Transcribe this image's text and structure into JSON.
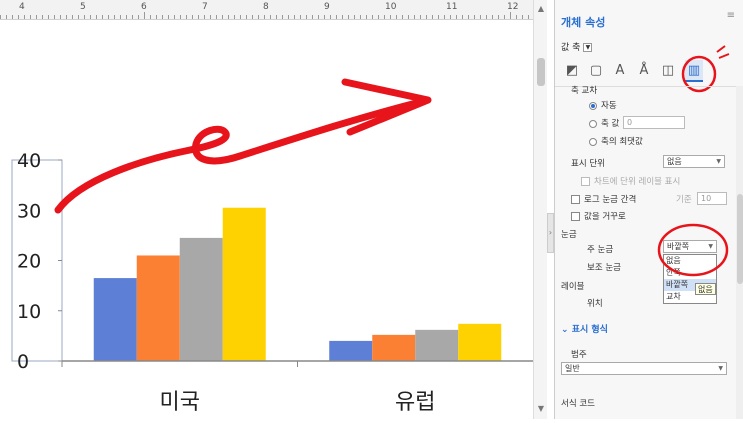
{
  "ruler": {
    "numbers": [
      "4",
      "5",
      "6",
      "7",
      "8",
      "9",
      "10",
      "11",
      "12"
    ]
  },
  "chart_data": {
    "type": "bar",
    "categories": [
      "미국",
      "유럽"
    ],
    "series": [
      {
        "values": [
          16.5,
          4
        ],
        "color": "#5e7fd6"
      },
      {
        "values": [
          21,
          5.2
        ],
        "color": "#fb8034"
      },
      {
        "values": [
          24.5,
          6.2
        ],
        "color": "#a8a8a8"
      },
      {
        "values": [
          30.5,
          7.4
        ],
        "color": "#fdd200"
      }
    ],
    "ylim": [
      0,
      40
    ],
    "yticks": [
      "0",
      "10",
      "20",
      "30",
      "40"
    ],
    "grid": false
  },
  "panel": {
    "title": "개체 속성",
    "axis_selector": "값 축",
    "tabs": [
      "fill-icon",
      "line-icon",
      "text-effect-icon",
      "text-icon",
      "shadow-icon",
      "axis-chart-icon"
    ],
    "axis_cross_label": "축 교차",
    "radio_auto": "자동",
    "radio_value": "축 값",
    "radio_value_input": "0",
    "radio_max": "축의 최댓값",
    "display_unit_label": "표시 단위",
    "display_unit_value": "없음",
    "show_unit_label": "차트에 단위 레이블 표시",
    "log_scale_label": "로그 눈금 간격",
    "log_base_label": "기준",
    "log_base_value": "10",
    "reverse_label": "값을 거꾸로",
    "ticks_label": "눈금",
    "major_tick_label": "주 눈금",
    "major_tick_value": "바깥쪽",
    "minor_tick_label": "보조 눈금",
    "tick_options": [
      "없음",
      "안쪽",
      "바깥쪽",
      "교차"
    ],
    "tooltip": "없음",
    "label_label": "레이블",
    "position_label": "위치",
    "format_section": "표시 형식",
    "category_label": "범주",
    "category_value": "일반",
    "format_code_label": "서식 코드"
  }
}
